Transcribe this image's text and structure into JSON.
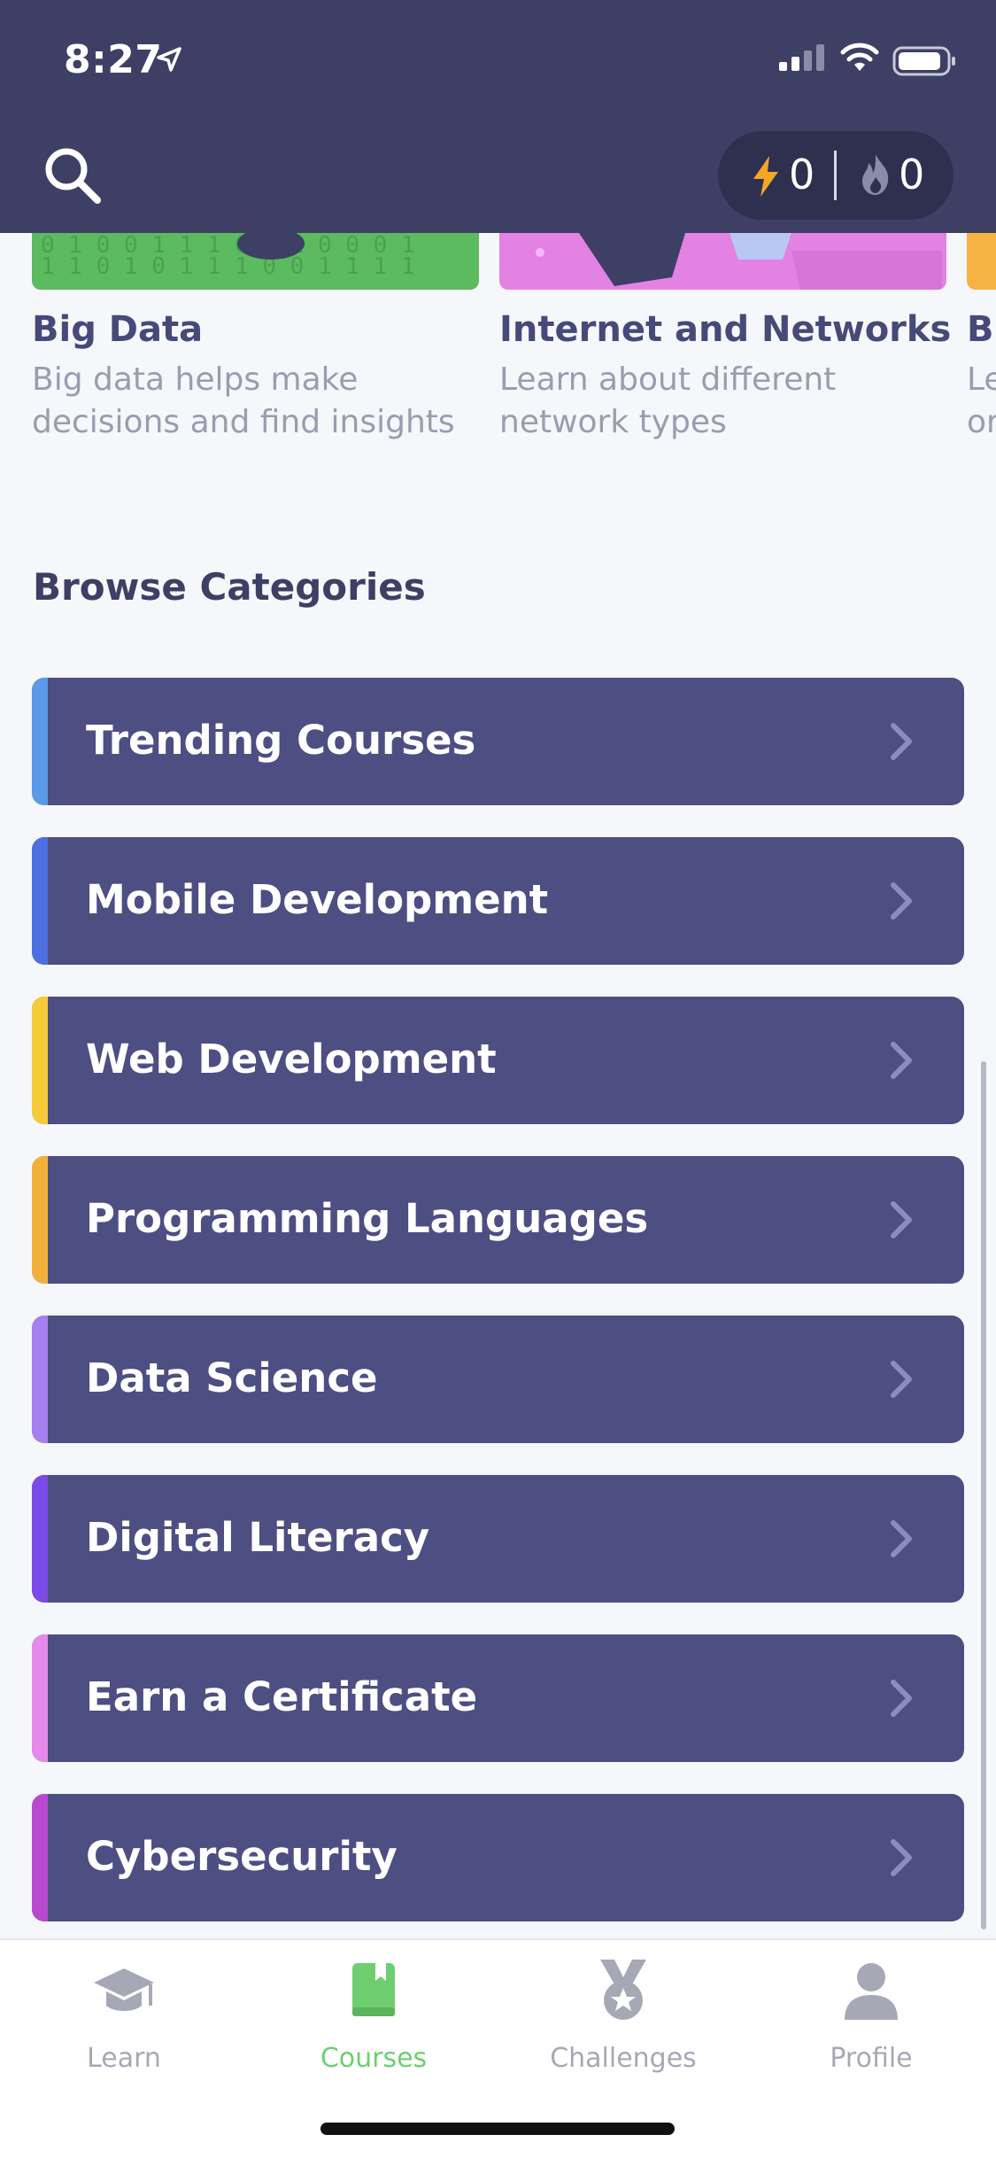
{
  "status_bar": {
    "time": "8:27"
  },
  "header": {
    "energy_value": "0",
    "streak_value": "0"
  },
  "featured_courses": [
    {
      "title": "Big Data",
      "desc_line1": "Big data helps make",
      "desc_line2": "decisions and find insights",
      "thumb_color": "#5cba5f"
    },
    {
      "title": "Internet and Networks",
      "desc_line1": "Learn about different",
      "desc_line2": "network types",
      "thumb_color": "#e382e3"
    },
    {
      "title": "Br",
      "desc_line1": "Le",
      "desc_line2": "or",
      "thumb_color": "#f4b342"
    }
  ],
  "browse": {
    "title": "Browse Categories",
    "categories": [
      {
        "label": "Trending Courses",
        "accent": "#5b9ae8"
      },
      {
        "label": "Mobile Development",
        "accent": "#4d6fe0"
      },
      {
        "label": "Web Development",
        "accent": "#f6cb3a"
      },
      {
        "label": "Programming Languages",
        "accent": "#f2b13a"
      },
      {
        "label": "Data Science",
        "accent": "#a77ff0"
      },
      {
        "label": "Digital Literacy",
        "accent": "#7c4ae8"
      },
      {
        "label": "Earn a Certificate",
        "accent": "#e58ae8"
      },
      {
        "label": "Cybersecurity",
        "accent": "#b84ad0"
      }
    ]
  },
  "tabbar": {
    "tabs": [
      {
        "label": "Learn",
        "icon": "graduation-cap-icon"
      },
      {
        "label": "Courses",
        "icon": "book-icon"
      },
      {
        "label": "Challenges",
        "icon": "medal-icon"
      },
      {
        "label": "Profile",
        "icon": "user-icon"
      }
    ],
    "active": "Courses",
    "active_color": "#6fcf70"
  }
}
